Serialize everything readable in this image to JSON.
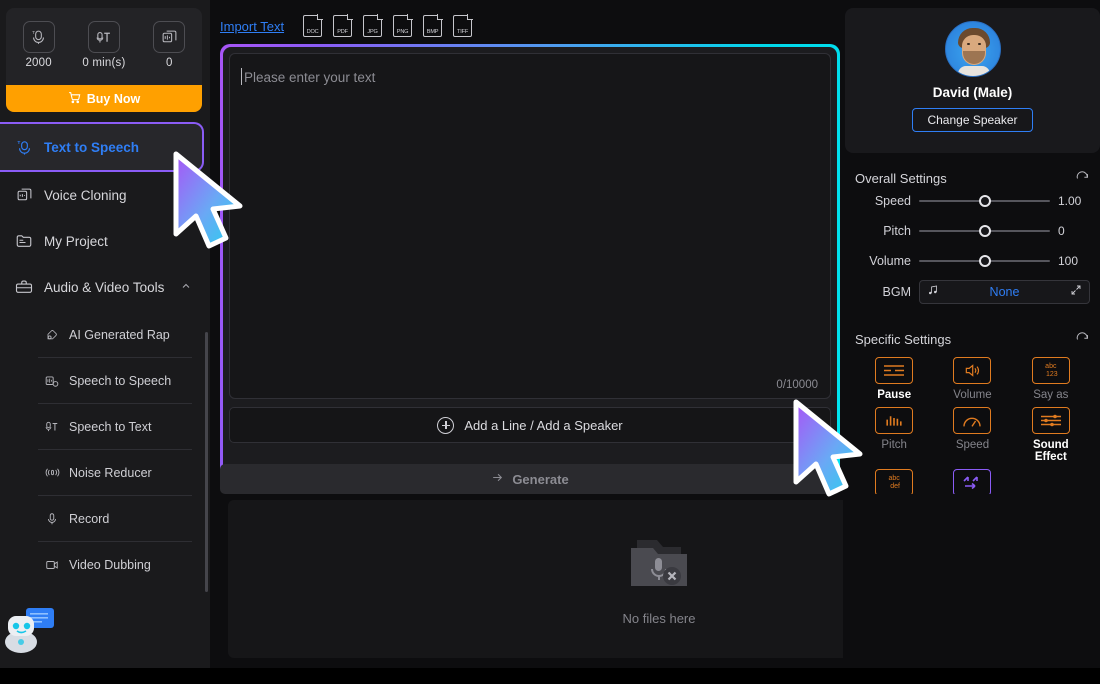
{
  "sidebar": {
    "credits": [
      {
        "icon": "characters-icon",
        "value": "2000"
      },
      {
        "icon": "duration-icon",
        "value": "0 min(s)"
      },
      {
        "icon": "projects-icon",
        "value": "0"
      }
    ],
    "buy_now_label": "Buy Now",
    "cart_icon": "cart-icon",
    "nav": [
      {
        "label": "Text to Speech",
        "icon": "text-to-speech-icon",
        "active": true
      },
      {
        "label": "Voice Cloning",
        "icon": "voice-cloning-icon",
        "active": false
      },
      {
        "label": "My Project",
        "icon": "folder-icon",
        "active": false
      },
      {
        "label": "Audio & Video Tools",
        "icon": "toolbox-icon",
        "active": false,
        "expanded": true,
        "chevron": "chevron-up-icon"
      }
    ],
    "subnav": [
      {
        "label": "AI Generated Rap",
        "icon": "mic-note-icon"
      },
      {
        "label": "Speech to Speech",
        "icon": "speech-to-speech-icon"
      },
      {
        "label": "Speech to Text",
        "icon": "speech-to-text-icon"
      },
      {
        "label": "Noise Reducer",
        "icon": "noise-reducer-icon"
      },
      {
        "label": "Record",
        "icon": "record-icon"
      },
      {
        "label": "Video Dubbing",
        "icon": "video-dubbing-icon"
      }
    ]
  },
  "toolbar": {
    "import_text_label": "Import Text",
    "formats": [
      "DOC",
      "PDF",
      "JPG",
      "PNG",
      "BMP",
      "TIFF"
    ],
    "actions": [
      {
        "name": "delete-icon"
      },
      {
        "name": "add-section-icon"
      },
      {
        "name": "undo-icon"
      },
      {
        "name": "redo-icon"
      }
    ]
  },
  "editor": {
    "placeholder": "Please enter your text",
    "value": "",
    "char_count": "0/10000",
    "add_line_label": "Add a Line / Add a Speaker",
    "generate_label": "Generate",
    "generate_arrow": "arrow-right-icon"
  },
  "files": {
    "empty_label": "No files here",
    "empty_icon": "folder-mic-empty-icon"
  },
  "speaker": {
    "name": "David (Male)",
    "change_label": "Change Speaker",
    "avatar": "avatar-david"
  },
  "overall_settings": {
    "title": "Overall Settings",
    "reset_icon": "refresh-icon",
    "sliders": [
      {
        "label": "Speed",
        "value": "1.00",
        "pos": 50
      },
      {
        "label": "Pitch",
        "value": "0",
        "pos": 50
      },
      {
        "label": "Volume",
        "value": "100",
        "pos": 50
      }
    ],
    "bgm": {
      "label": "BGM",
      "value": "None",
      "music_icon": "music-note-icon",
      "expand_icon": "expand-icon"
    }
  },
  "specific_settings": {
    "title": "Specific Settings",
    "reset_icon": "refresh-icon",
    "effects": [
      {
        "label": "Pause",
        "icon": "pause-lines-icon",
        "selected": true,
        "color": "#e07b20"
      },
      {
        "label": "Volume",
        "icon": "speaker-icon",
        "selected": false,
        "color": "#e07b20"
      },
      {
        "label": "Say as",
        "icon": "abc123-icon",
        "selected": false,
        "color": "#e07b20"
      },
      {
        "label": "Pitch",
        "icon": "bars-icon",
        "selected": false,
        "color": "#e07b20"
      },
      {
        "label": "Speed",
        "icon": "gauge-icon",
        "selected": false,
        "color": "#e07b20"
      },
      {
        "label": "Sound Effect",
        "icon": "equalizer-icon",
        "selected": true,
        "color": "#e07b20"
      },
      {
        "label": "",
        "icon": "abcdef-icon",
        "selected": false,
        "color": "#e07b20"
      },
      {
        "label": "",
        "icon": "arrows-icon",
        "selected": false,
        "color": "#8b5cf6"
      }
    ]
  },
  "colors": {
    "accent_blue": "#2f7ef5",
    "accent_orange": "#ffa000",
    "gradient_start": "#a855f7",
    "gradient_end": "#00e5f2",
    "effect_orange": "#e07b20",
    "effect_violet": "#8b5cf6"
  }
}
